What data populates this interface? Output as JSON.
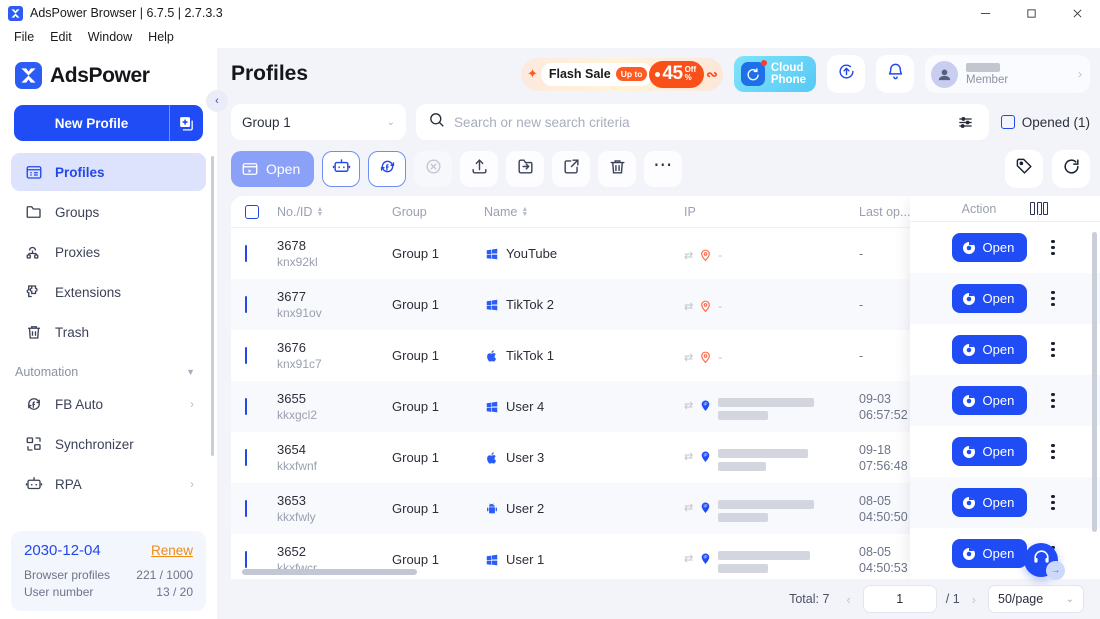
{
  "window": {
    "title": "AdsPower Browser | 6.7.5 | 2.7.3.3",
    "minimize": "─",
    "maximize": "□",
    "close": "✕"
  },
  "menubar": [
    "File",
    "Edit",
    "Window",
    "Help"
  ],
  "sidebar": {
    "brand": "AdsPower",
    "new_profile": "New Profile",
    "nav": [
      {
        "label": "Profiles",
        "icon": "profiles-icon",
        "active": true
      },
      {
        "label": "Groups",
        "icon": "groups-icon",
        "active": false
      },
      {
        "label": "Proxies",
        "icon": "proxies-icon",
        "active": false
      },
      {
        "label": "Extensions",
        "icon": "extensions-icon",
        "active": false
      },
      {
        "label": "Trash",
        "icon": "trash-icon",
        "active": false
      }
    ],
    "automation_label": "Automation",
    "automation": [
      {
        "label": "FB Auto",
        "icon": "fb-auto-icon",
        "chevron": "›"
      },
      {
        "label": "Synchronizer",
        "icon": "synchronizer-icon",
        "chevron": ""
      },
      {
        "label": "RPA",
        "icon": "rpa-icon",
        "chevron": "›"
      }
    ],
    "license": {
      "date": "2030-12-04",
      "renew": "Renew",
      "rows": [
        {
          "label": "Browser profiles",
          "value": "221 / 1000"
        },
        {
          "label": "User number",
          "value": "13 / 20"
        }
      ]
    },
    "collapse": "‹"
  },
  "header": {
    "title": "Profiles",
    "promo": {
      "flash": "Flash Sale",
      "upto": "Up to",
      "amount": "45",
      "off_top": "Off",
      "off_bottom": "%"
    },
    "cloud_phone": {
      "line1": "Cloud",
      "line2": "Phone"
    },
    "sync_icon": "sync-upload-icon",
    "bell_icon": "bell-icon",
    "member": {
      "label": "Member",
      "arrow": "›"
    }
  },
  "filters": {
    "group": "Group 1",
    "group_caret": "⌄",
    "search_placeholder": "Search or new search criteria",
    "search_value": "",
    "adv_icon": "filter-sliders-icon",
    "opened_label": "Opened (1)"
  },
  "toolbar": {
    "open_label": "Open",
    "buttons": [
      {
        "name": "rpa-button",
        "icon": "robot-icon",
        "style": "outlined"
      },
      {
        "name": "fb-sync-button",
        "icon": "fb-refresh-icon",
        "style": "outlined"
      },
      {
        "name": "close-button",
        "icon": "circle-x-icon",
        "style": "ghost"
      },
      {
        "name": "upload-button",
        "icon": "upload-icon",
        "style": "flat"
      },
      {
        "name": "move-to-group-button",
        "icon": "move-folder-icon",
        "style": "flat"
      },
      {
        "name": "export-button",
        "icon": "export-icon",
        "style": "flat"
      },
      {
        "name": "delete-button",
        "icon": "trash-icon",
        "style": "flat"
      },
      {
        "name": "more-button",
        "icon": "ellipsis-icon",
        "style": "flat"
      }
    ],
    "right": [
      {
        "name": "tag-button",
        "icon": "tag-icon"
      },
      {
        "name": "refresh-button",
        "icon": "refresh-icon"
      }
    ]
  },
  "table": {
    "columns": [
      "No./ID",
      "Group",
      "Name",
      "IP",
      "Last op...",
      "Action"
    ],
    "column_settings_icon": "column-settings-icon",
    "rows": [
      {
        "id": "3678",
        "uid": "knx92kl",
        "group": "Group 1",
        "name": "YouTube",
        "os": "windows",
        "ip_kind": "none",
        "ip_value": "-",
        "last_date": "-",
        "last_time": "",
        "action": "Open"
      },
      {
        "id": "3677",
        "uid": "knx91ov",
        "group": "Group 1",
        "name": "TikTok 2",
        "os": "windows",
        "ip_kind": "none",
        "ip_value": "-",
        "last_date": "-",
        "last_time": "",
        "action": "Open"
      },
      {
        "id": "3676",
        "uid": "knx91c7",
        "group": "Group 1",
        "name": "TikTok 1",
        "os": "apple",
        "ip_kind": "none",
        "ip_value": "-",
        "last_date": "-",
        "last_time": "",
        "action": "Open"
      },
      {
        "id": "3655",
        "uid": "kkxgcl2",
        "group": "Group 1",
        "name": "User 4",
        "os": "windows",
        "ip_kind": "ip",
        "ip_value": "",
        "last_date": "09-03",
        "last_time": "06:57:52",
        "action": "Open"
      },
      {
        "id": "3654",
        "uid": "kkxfwnf",
        "group": "Group 1",
        "name": "User 3",
        "os": "apple",
        "ip_kind": "ip",
        "ip_value": "",
        "last_date": "09-18",
        "last_time": "07:56:48",
        "action": "Open"
      },
      {
        "id": "3653",
        "uid": "kkxfwly",
        "group": "Group 1",
        "name": "User 2",
        "os": "android",
        "ip_kind": "ip",
        "ip_value": "",
        "last_date": "08-05",
        "last_time": "04:50:50",
        "action": "Open"
      },
      {
        "id": "3652",
        "uid": "kkxfwcr",
        "group": "Group 1",
        "name": "User 1",
        "os": "windows",
        "ip_kind": "ip",
        "ip_value": "",
        "last_date": "08-05",
        "last_time": "04:50:53",
        "action": "Open"
      }
    ]
  },
  "footer": {
    "total": "Total: 7",
    "prev": "‹",
    "next": "›",
    "page": "1",
    "of": "/ 1",
    "page_size": "50/page",
    "caret": "⌄"
  },
  "fab": {
    "icon": "support-headset-icon",
    "arrow": "→"
  },
  "colors": {
    "primary": "#1f4cf5",
    "accent_orange": "#f9501a",
    "active_bg": "#dde3fd"
  }
}
